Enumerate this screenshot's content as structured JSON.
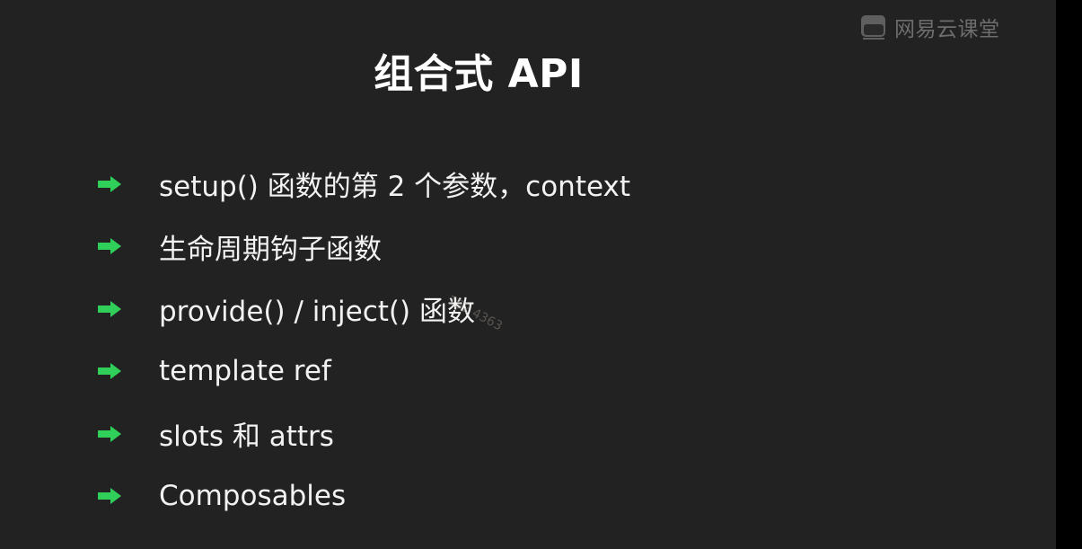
{
  "slide": {
    "title": "组合式 API",
    "brand": "网易云课堂",
    "watermark": "152 4363",
    "bullets": [
      "setup() 函数的第 2 个参数，context",
      "生命周期钩子函数",
      "provide() / inject() 函数",
      "template ref",
      "slots 和 attrs",
      "Composables"
    ]
  },
  "icons": {
    "brand_logo": "netease-cloud-classroom-logo-icon",
    "bullet": "right-arrow-icon"
  },
  "colors": {
    "background": "#222223",
    "title": "#ffffff",
    "bullet_text": "#f2f2f2",
    "bullet_arrow": "#2fcf5a",
    "brand_logo": "#6d6d6d"
  }
}
